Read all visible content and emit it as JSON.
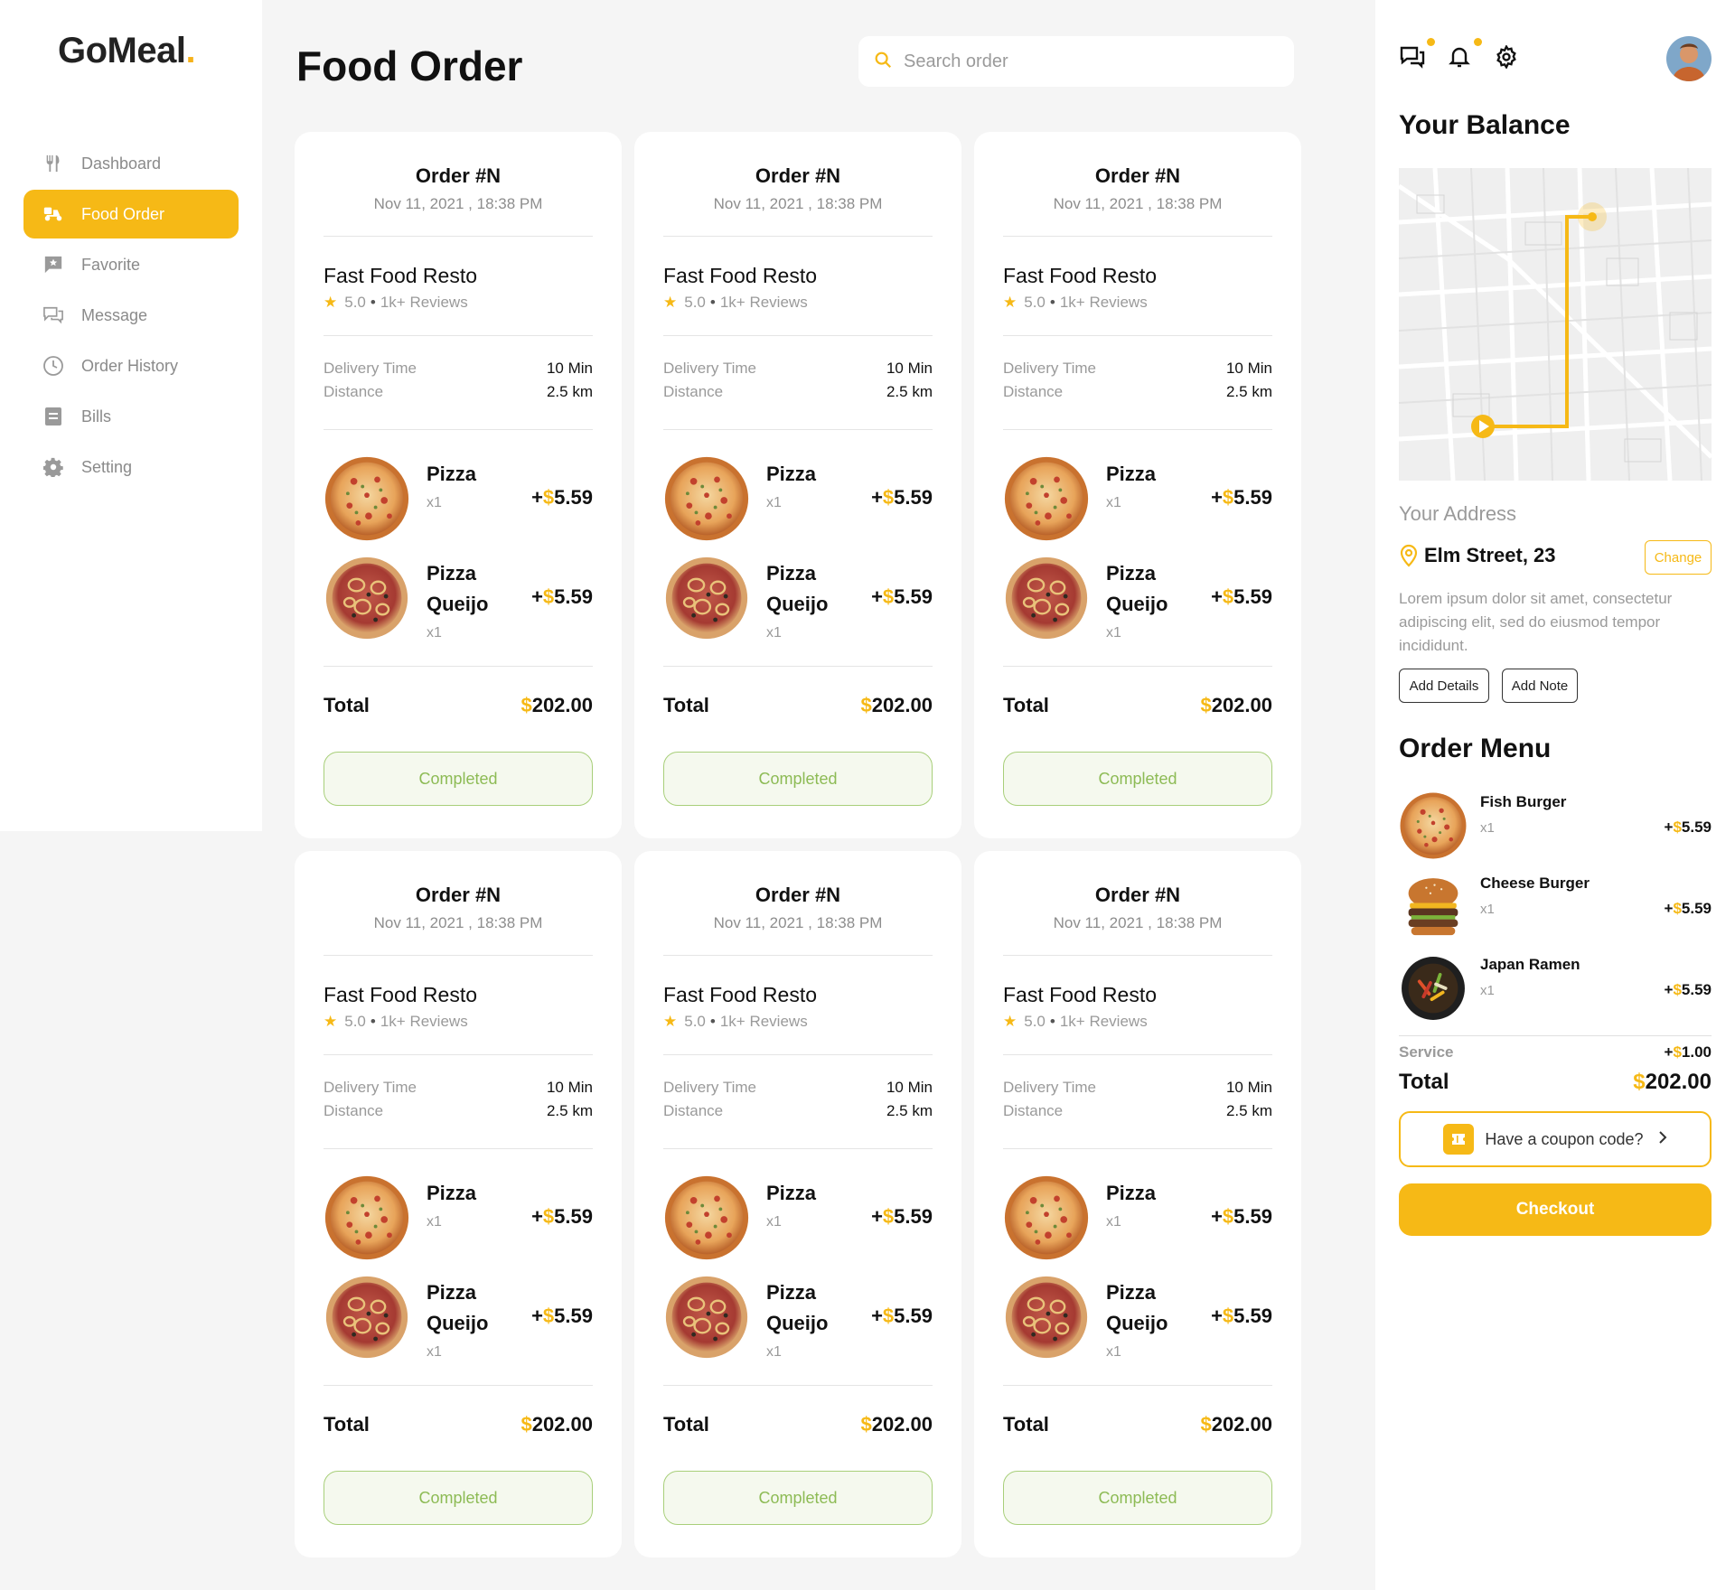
{
  "brand": {
    "name": "GoMeal",
    "dot": "."
  },
  "sidebar": {
    "items": [
      {
        "label": "Dashboard",
        "icon": "utensils-icon",
        "active": false
      },
      {
        "label": "Food Order",
        "icon": "delivery-scooter-icon",
        "active": true
      },
      {
        "label": "Favorite",
        "icon": "star-message-icon",
        "active": false
      },
      {
        "label": "Message",
        "icon": "chat-icon",
        "active": false
      },
      {
        "label": "Order History",
        "icon": "clock-icon",
        "active": false
      },
      {
        "label": "Bills",
        "icon": "bill-icon",
        "active": false
      },
      {
        "label": "Setting",
        "icon": "gear-icon",
        "active": false
      }
    ]
  },
  "header": {
    "title": "Food Order",
    "search_placeholder": "Search order"
  },
  "orders": [
    {
      "order_no": "Order #N",
      "date": "Nov 11, 2021 , 18:38 PM",
      "resto": "Fast Food Resto",
      "rating": "5.0",
      "reviews": "1k+ Reviews",
      "delivery_label": "Delivery Time",
      "delivery_value": "10 Min",
      "distance_label": "Distance",
      "distance_value": "2.5 km",
      "items": [
        {
          "name": "Pizza",
          "qty": "x1",
          "sign": "+",
          "currency": "$",
          "price": "5.59"
        },
        {
          "name": "Pizza Queijo",
          "qty": "x1",
          "sign": "+",
          "currency": "$",
          "price": "5.59"
        }
      ],
      "total_label": "Total",
      "total_currency": "$",
      "total_value": "202.00",
      "status": "Completed"
    },
    {
      "order_no": "Order #N",
      "date": "Nov 11, 2021 , 18:38 PM",
      "resto": "Fast Food Resto",
      "rating": "5.0",
      "reviews": "1k+ Reviews",
      "delivery_label": "Delivery Time",
      "delivery_value": "10 Min",
      "distance_label": "Distance",
      "distance_value": "2.5 km",
      "items": [
        {
          "name": "Pizza",
          "qty": "x1",
          "sign": "+",
          "currency": "$",
          "price": "5.59"
        },
        {
          "name": "Pizza Queijo",
          "qty": "x1",
          "sign": "+",
          "currency": "$",
          "price": "5.59"
        }
      ],
      "total_label": "Total",
      "total_currency": "$",
      "total_value": "202.00",
      "status": "Completed"
    },
    {
      "order_no": "Order #N",
      "date": "Nov 11, 2021 , 18:38 PM",
      "resto": "Fast Food Resto",
      "rating": "5.0",
      "reviews": "1k+ Reviews",
      "delivery_label": "Delivery Time",
      "delivery_value": "10 Min",
      "distance_label": "Distance",
      "distance_value": "2.5 km",
      "items": [
        {
          "name": "Pizza",
          "qty": "x1",
          "sign": "+",
          "currency": "$",
          "price": "5.59"
        },
        {
          "name": "Pizza Queijo",
          "qty": "x1",
          "sign": "+",
          "currency": "$",
          "price": "5.59"
        }
      ],
      "total_label": "Total",
      "total_currency": "$",
      "total_value": "202.00",
      "status": "Completed"
    },
    {
      "order_no": "Order #N",
      "date": "Nov 11, 2021 , 18:38 PM",
      "resto": "Fast Food Resto",
      "rating": "5.0",
      "reviews": "1k+ Reviews",
      "delivery_label": "Delivery Time",
      "delivery_value": "10 Min",
      "distance_label": "Distance",
      "distance_value": "2.5 km",
      "items": [
        {
          "name": "Pizza",
          "qty": "x1",
          "sign": "+",
          "currency": "$",
          "price": "5.59"
        },
        {
          "name": "Pizza Queijo",
          "qty": "x1",
          "sign": "+",
          "currency": "$",
          "price": "5.59"
        }
      ],
      "total_label": "Total",
      "total_currency": "$",
      "total_value": "202.00",
      "status": "Completed"
    },
    {
      "order_no": "Order #N",
      "date": "Nov 11, 2021 , 18:38 PM",
      "resto": "Fast Food Resto",
      "rating": "5.0",
      "reviews": "1k+ Reviews",
      "delivery_label": "Delivery Time",
      "delivery_value": "10 Min",
      "distance_label": "Distance",
      "distance_value": "2.5 km",
      "items": [
        {
          "name": "Pizza",
          "qty": "x1",
          "sign": "+",
          "currency": "$",
          "price": "5.59"
        },
        {
          "name": "Pizza Queijo",
          "qty": "x1",
          "sign": "+",
          "currency": "$",
          "price": "5.59"
        }
      ],
      "total_label": "Total",
      "total_currency": "$",
      "total_value": "202.00",
      "status": "Completed"
    },
    {
      "order_no": "Order #N",
      "date": "Nov 11, 2021 , 18:38 PM",
      "resto": "Fast Food Resto",
      "rating": "5.0",
      "reviews": "1k+ Reviews",
      "delivery_label": "Delivery Time",
      "delivery_value": "10 Min",
      "distance_label": "Distance",
      "distance_value": "2.5 km",
      "items": [
        {
          "name": "Pizza",
          "qty": "x1",
          "sign": "+",
          "currency": "$",
          "price": "5.59"
        },
        {
          "name": "Pizza Queijo",
          "qty": "x1",
          "sign": "+",
          "currency": "$",
          "price": "5.59"
        }
      ],
      "total_label": "Total",
      "total_currency": "$",
      "total_value": "202.00",
      "status": "Completed"
    }
  ],
  "right_panel": {
    "balance_title": "Your Balance",
    "address_label": "Your Address",
    "address_name": "Elm Street, 23",
    "change_label": "Change",
    "address_desc": "Lorem ipsum dolor sit amet, consectetur adipiscing elit, sed do eiusmod tempor incididunt.",
    "add_details_label": "Add Details",
    "add_note_label": "Add Note",
    "order_menu_title": "Order Menu",
    "menu": [
      {
        "name": "Fish Burger",
        "qty": "x1",
        "sign": "+",
        "currency": "$",
        "price": "5.59",
        "image": "pizza"
      },
      {
        "name": "Cheese Burger",
        "qty": "x1",
        "sign": "+",
        "currency": "$",
        "price": "5.59",
        "image": "burger"
      },
      {
        "name": "Japan Ramen",
        "qty": "x1",
        "sign": "+",
        "currency": "$",
        "price": "5.59",
        "image": "ramen"
      }
    ],
    "service_label": "Service",
    "service_sign": "+",
    "service_currency": "$",
    "service_value": "1.00",
    "total_label": "Total",
    "total_currency": "$",
    "total_value": "202.00",
    "coupon_label": "Have a coupon code?",
    "checkout_label": "Checkout"
  },
  "colors": {
    "accent": "#f6b916",
    "completed_border": "#a8cf7a",
    "completed_text": "#8dbb55",
    "muted": "#9a9a9a"
  }
}
